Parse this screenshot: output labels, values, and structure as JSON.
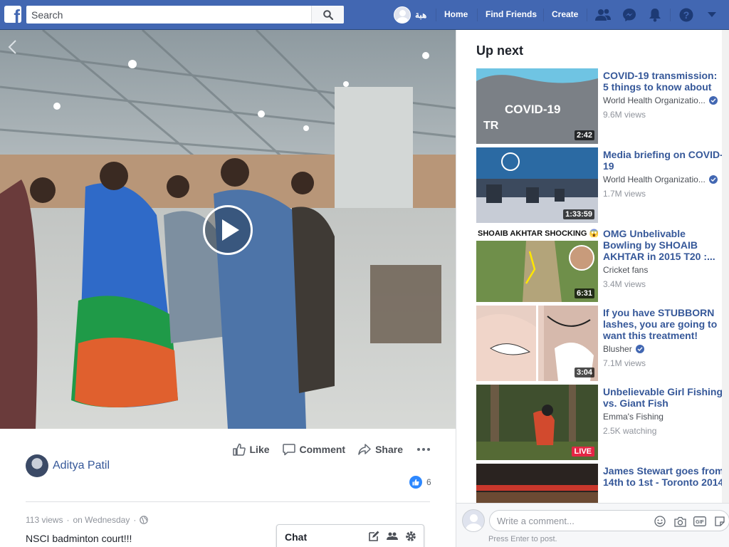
{
  "topbar": {
    "search_placeholder": "Search",
    "user_name": "هبة",
    "home": "Home",
    "find_friends": "Find Friends",
    "create": "Create",
    "brand_color": "#4267b2"
  },
  "post": {
    "actions": {
      "like": "Like",
      "comment": "Comment",
      "share": "Share"
    },
    "author": "Aditya Patil",
    "reaction_count": "6",
    "views": "113 views",
    "separator": "·",
    "date": "on Wednesday",
    "caption": "NSCI badminton court!!!"
  },
  "chat": {
    "label": "Chat"
  },
  "up_next": {
    "title": "Up next",
    "items": [
      {
        "title": "COVID-19 transmission: 5 things to know about",
        "channel": "World Health Organizatio...",
        "verified": true,
        "views": "9.6M views",
        "badge": "2:42",
        "thumb_text": "COVID-19",
        "thumb_subtext": "TR"
      },
      {
        "title": "Media briefing on COVID-19",
        "channel": "World Health Organizatio...",
        "verified": true,
        "views": "1.7M views",
        "badge": "1:33:59"
      },
      {
        "title": "OMG Unbelivable Bowling by SHOAIB AKHTAR in 2015 T20 :...",
        "channel": "Cricket fans",
        "verified": false,
        "views": "3.4M views",
        "badge": "6:31",
        "thumb_text": "SHOAIB AKHTAR SHOCKING 😱"
      },
      {
        "title": "If you have STUBBORN lashes, you are going to want this treatment!",
        "channel": "Blusher",
        "verified": true,
        "views": "7.1M views",
        "badge": "3:04"
      },
      {
        "title": "Unbelievable Girl Fishing vs. Giant Fish",
        "channel": "Emma's Fishing",
        "verified": false,
        "views": "2.5K watching",
        "badge": "LIVE"
      },
      {
        "title": "James Stewart goes from 14th to 1st - Toronto 2014",
        "channel": "",
        "verified": false,
        "views": "",
        "badge": ""
      }
    ]
  },
  "comment": {
    "placeholder": "Write a comment...",
    "hint": "Press Enter to post."
  }
}
